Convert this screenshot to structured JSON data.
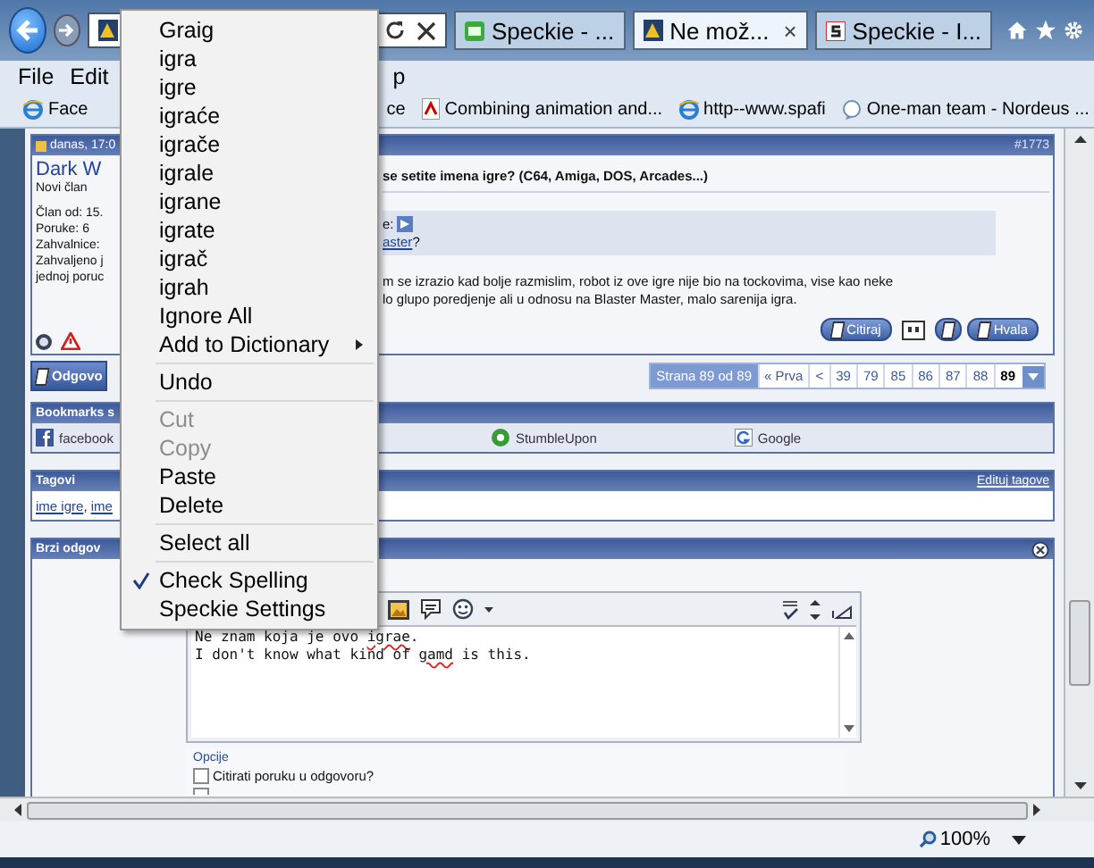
{
  "browser": {
    "tabs": [
      {
        "label": "Speckie - ...",
        "selected": false
      },
      {
        "label": "Ne mož...",
        "selected": true
      },
      {
        "label": "Speckie - I...",
        "selected": false
      }
    ],
    "close_tab": "×",
    "menu_bar": [
      "File",
      "Edit",
      "p"
    ],
    "favorites": [
      "Face",
      "ce",
      "Combining animation and...",
      "http--www.spafi",
      "One-man team - Nordeus ..."
    ],
    "zoom": "100%"
  },
  "post": {
    "date": "danas, 17:0",
    "number": "#1773",
    "user": "Dark W",
    "rank": "Novi član",
    "user_info": [
      "Član od: 15.",
      "Poruke: 6",
      "Zahvalnice: ",
      "Zahvaljeno j",
      "jednoj poruc"
    ],
    "title": "se setite imena igre? (C64, Amiga, DOS, Arcades...)",
    "quote": {
      "line1": "e:",
      "link": "aster",
      "after": "?"
    },
    "message": [
      "m se izrazio kad bolje razmislim, robot iz ove igre nije bio na tockovima, vise kao neke",
      "lo glupo poredjenje ali u odnosu na Blaster Master, malo sarenija igra."
    ],
    "quote_button": "Citiraj",
    "thanks_button": "Hvala",
    "reply_button": "Odgovo"
  },
  "pagination": {
    "label": "Strana 89 od 89",
    "pages": [
      {
        "label": "« Prva",
        "selected": false
      },
      {
        "label": "<",
        "selected": false
      },
      {
        "label": "39",
        "selected": false
      },
      {
        "label": "79",
        "selected": false
      },
      {
        "label": "85",
        "selected": false
      },
      {
        "label": "86",
        "selected": false
      },
      {
        "label": "87",
        "selected": false
      },
      {
        "label": "88",
        "selected": false
      },
      {
        "label": "89",
        "selected": true
      }
    ]
  },
  "bookmarks": {
    "title": "Bookmarks s",
    "items": [
      "facebook",
      "StumbleUpon",
      "Google"
    ]
  },
  "tags": {
    "title": "Tagovi",
    "edit": "Edituj tagove",
    "items": [
      "ime igre",
      "ime"
    ],
    "separator": ", "
  },
  "quick_reply": {
    "title": "Brzi odgov",
    "lines": [
      [
        {
          "text": "Ne znam koja je ovo ",
          "misspelled": false
        },
        {
          "text": "igrae",
          "misspelled": true
        },
        {
          "text": ".",
          "misspelled": false
        }
      ],
      [
        {
          "text": "I don't know what kind of ",
          "misspelled": false
        },
        {
          "text": "gamd",
          "misspelled": true
        },
        {
          "text": " is this.",
          "misspelled": false
        }
      ]
    ],
    "options_title": "Opcije",
    "options": [
      {
        "label": "Citirati poruku u odgovoru?",
        "checked": false
      }
    ]
  },
  "context_menu": [
    {
      "kind": "item",
      "label": "Graig",
      "disabled": false,
      "checked": false,
      "submenu": false
    },
    {
      "kind": "item",
      "label": "igra",
      "disabled": false,
      "checked": false,
      "submenu": false
    },
    {
      "kind": "item",
      "label": "igre",
      "disabled": false,
      "checked": false,
      "submenu": false
    },
    {
      "kind": "item",
      "label": "igraće",
      "disabled": false,
      "checked": false,
      "submenu": false
    },
    {
      "kind": "item",
      "label": "igrače",
      "disabled": false,
      "checked": false,
      "submenu": false
    },
    {
      "kind": "item",
      "label": "igrale",
      "disabled": false,
      "checked": false,
      "submenu": false
    },
    {
      "kind": "item",
      "label": "igrane",
      "disabled": false,
      "checked": false,
      "submenu": false
    },
    {
      "kind": "item",
      "label": "igrate",
      "disabled": false,
      "checked": false,
      "submenu": false
    },
    {
      "kind": "item",
      "label": "igrač",
      "disabled": false,
      "checked": false,
      "submenu": false
    },
    {
      "kind": "item",
      "label": "igrah",
      "disabled": false,
      "checked": false,
      "submenu": false
    },
    {
      "kind": "item",
      "label": "Ignore All",
      "disabled": false,
      "checked": false,
      "submenu": false
    },
    {
      "kind": "item",
      "label": "Add to Dictionary",
      "disabled": false,
      "checked": false,
      "submenu": true
    },
    {
      "kind": "separator"
    },
    {
      "kind": "item",
      "label": "Undo",
      "disabled": false,
      "checked": false,
      "submenu": false
    },
    {
      "kind": "separator"
    },
    {
      "kind": "item",
      "label": "Cut",
      "disabled": true,
      "checked": false,
      "submenu": false
    },
    {
      "kind": "item",
      "label": "Copy",
      "disabled": true,
      "checked": false,
      "submenu": false
    },
    {
      "kind": "item",
      "label": "Paste",
      "disabled": false,
      "checked": false,
      "submenu": false
    },
    {
      "kind": "item",
      "label": "Delete",
      "disabled": false,
      "checked": false,
      "submenu": false
    },
    {
      "kind": "separator"
    },
    {
      "kind": "item",
      "label": "Select all",
      "disabled": false,
      "checked": false,
      "submenu": false
    },
    {
      "kind": "separator"
    },
    {
      "kind": "item",
      "label": "Check Spelling",
      "disabled": false,
      "checked": true,
      "submenu": false
    },
    {
      "kind": "item",
      "label": "Speckie Settings",
      "disabled": false,
      "checked": false,
      "submenu": false
    }
  ]
}
